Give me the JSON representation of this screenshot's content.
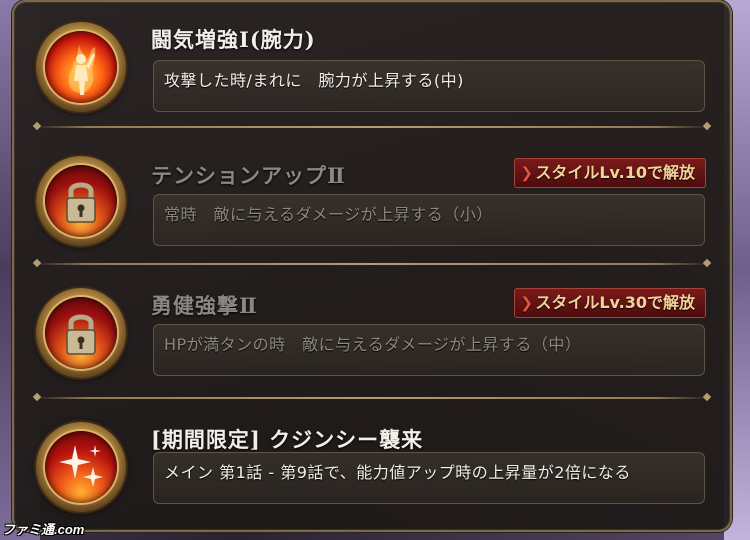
{
  "skills": [
    {
      "title": "闘気増強Ⅰ(腕力)",
      "description": "攻撃した時/まれに　腕力が上昇する(中)",
      "locked": false,
      "badge": "",
      "icon": "flame-figure-icon"
    },
    {
      "title": "テンションアップⅡ",
      "description": "常時　敵に与えるダメージが上昇する（小）",
      "locked": true,
      "badge": "スタイルLv.10で解放",
      "icon": "padlock-icon"
    },
    {
      "title": "勇健強撃Ⅱ",
      "description": "HPが満タンの時　敵に与えるダメージが上昇する（中）",
      "locked": true,
      "badge": "スタイルLv.30で解放",
      "icon": "padlock-icon"
    },
    {
      "title": "[期間限定] クジンシー襲来",
      "description": "メイン 第1話 - 第9話で、能力値アップ時の上昇量が2倍になる",
      "locked": false,
      "badge": "",
      "icon": "sparkle-icon"
    }
  ],
  "watermark": "ファミ通.com",
  "colors": {
    "badge_bg": "#7a1a1a",
    "badge_text": "#f3d29a",
    "frame_gold": "#b59d70"
  }
}
